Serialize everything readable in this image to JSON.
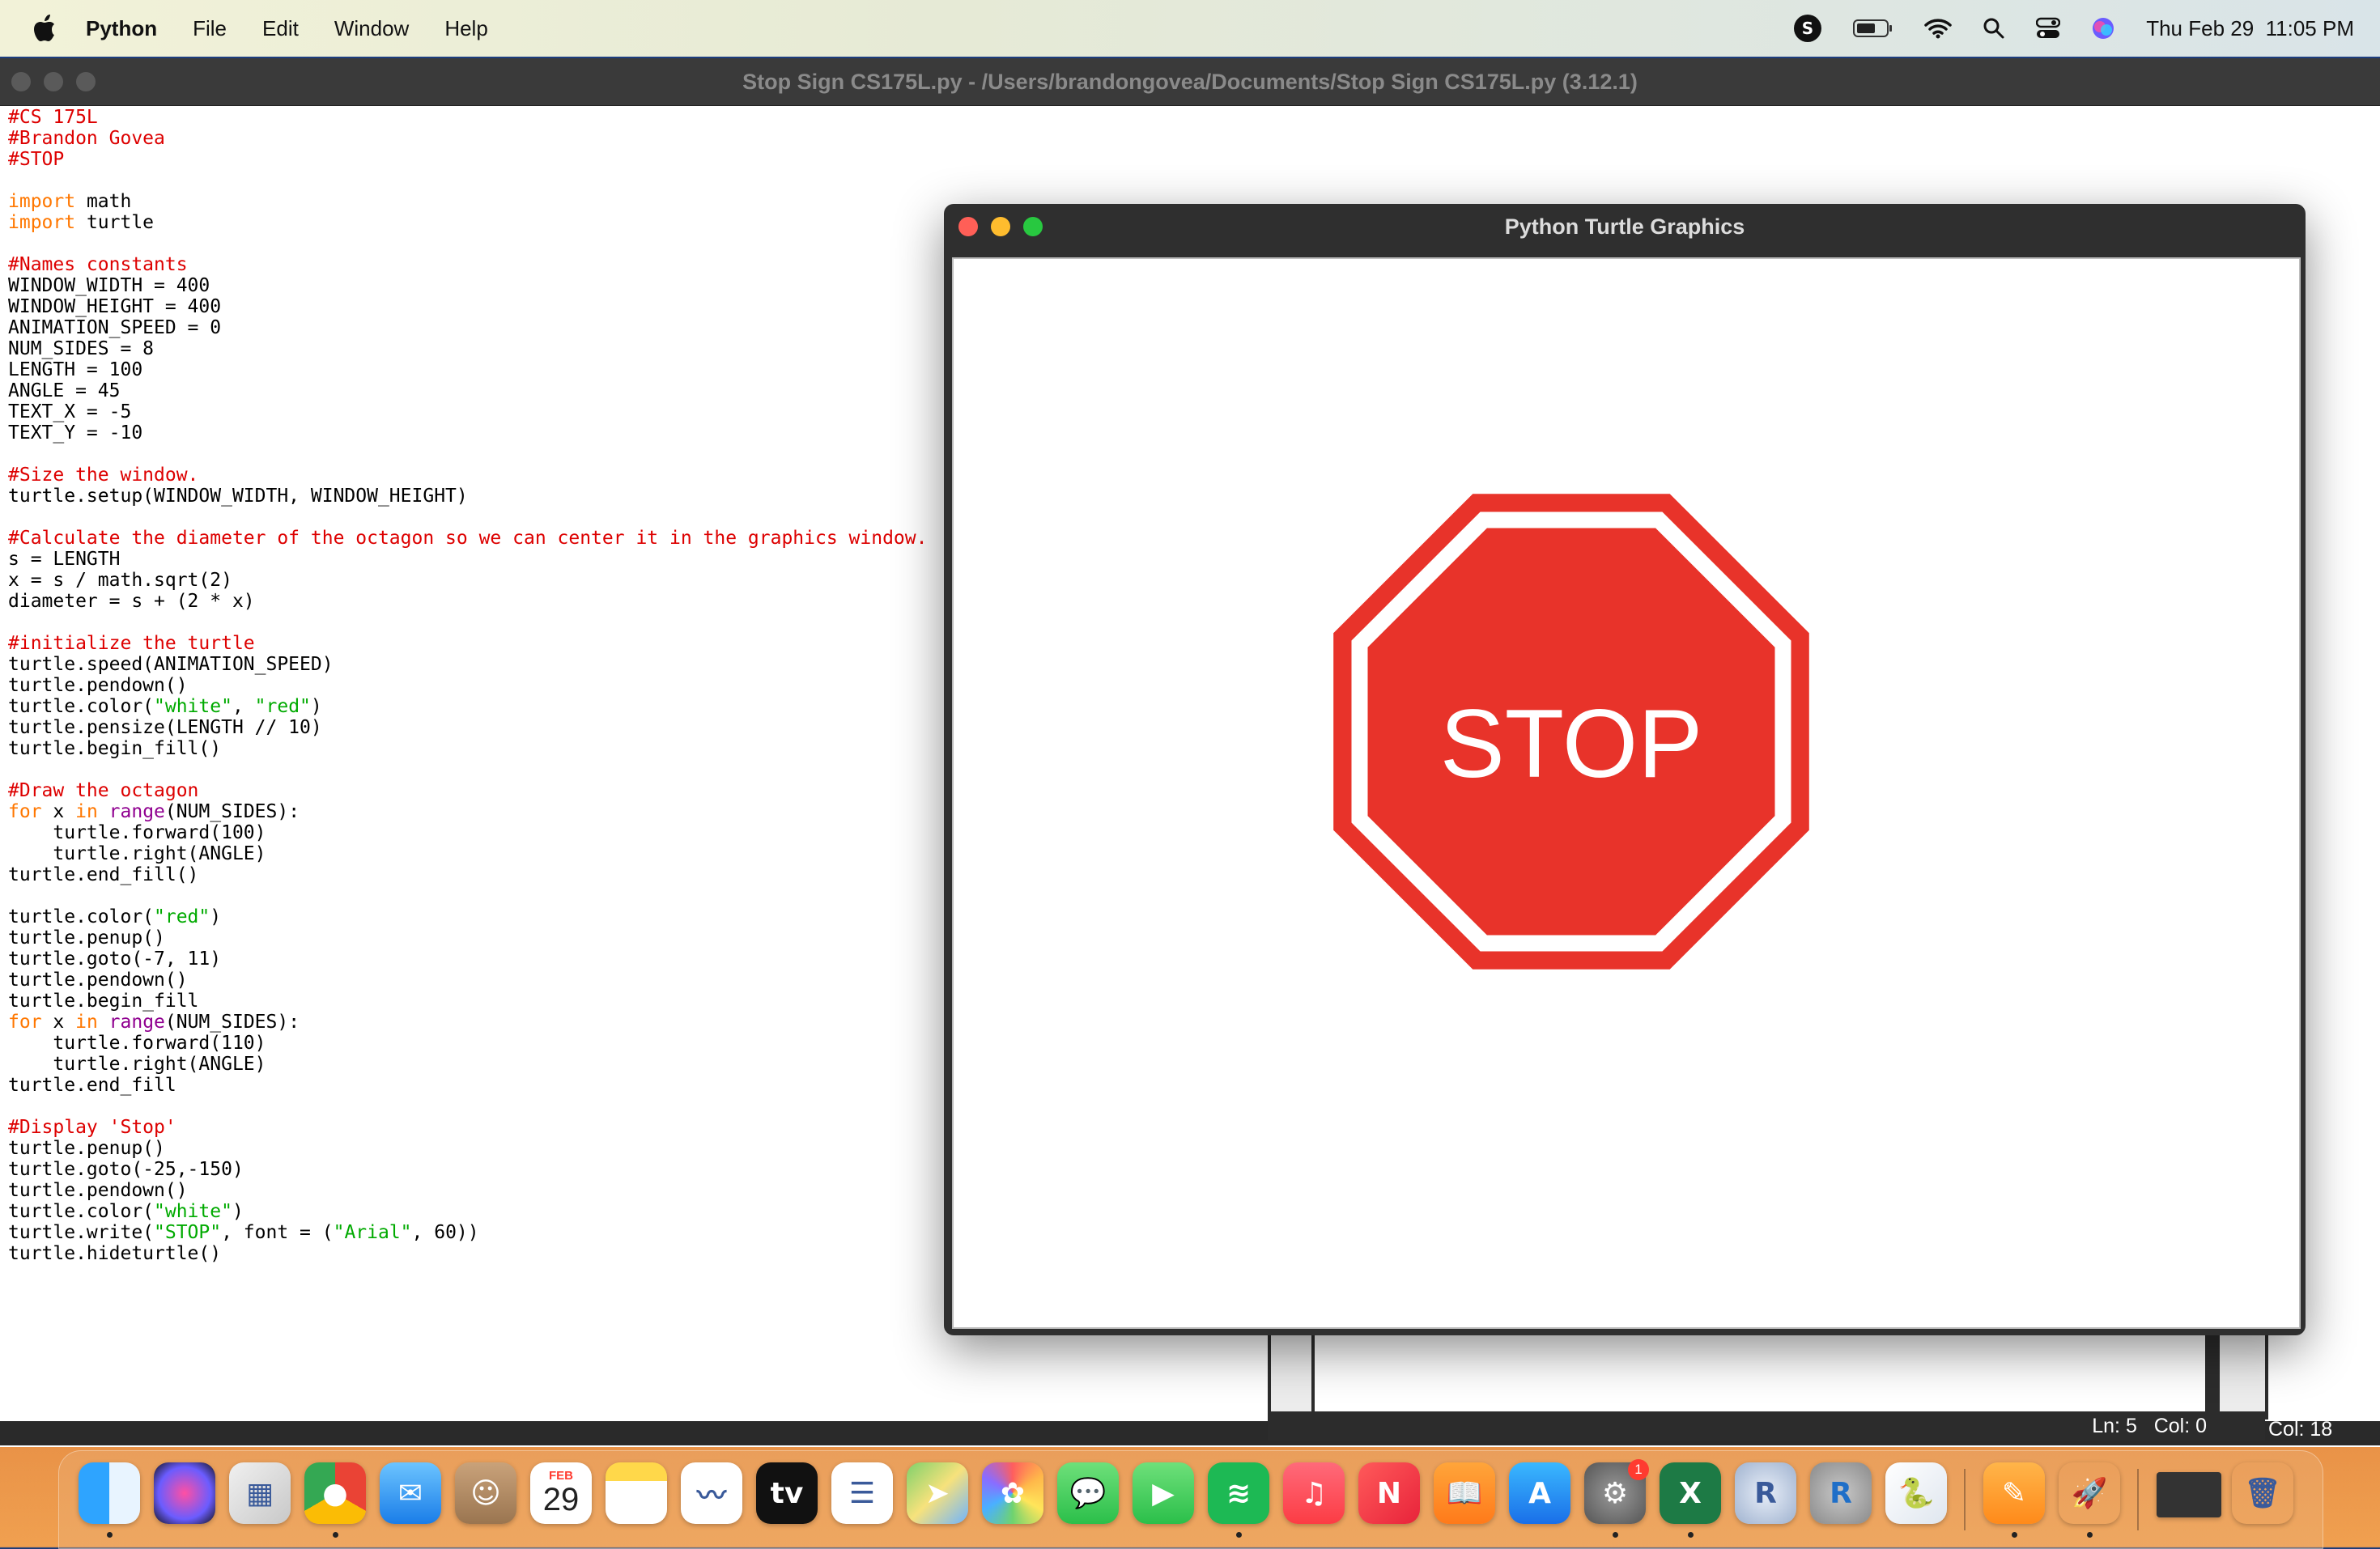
{
  "menubar": {
    "app": "Python",
    "items": [
      "File",
      "Edit",
      "Window",
      "Help"
    ],
    "datetime": "Thu Feb 29  11:05 PM"
  },
  "editor": {
    "title": "Stop Sign CS175L.py - /Users/brandongovea/Documents/Stop Sign CS175L.py (3.12.1)",
    "code_lines": [
      [
        [
          "c",
          "#CS 175L"
        ]
      ],
      [
        [
          "c",
          "#Brandon Govea"
        ]
      ],
      [
        [
          "c",
          "#STOP"
        ]
      ],
      [],
      [
        [
          "k",
          "import"
        ],
        [
          "t",
          " math"
        ]
      ],
      [
        [
          "k",
          "import"
        ],
        [
          "t",
          " turtle"
        ]
      ],
      [],
      [
        [
          "c",
          "#Names constants"
        ]
      ],
      [
        [
          "t",
          "WINDOW_WIDTH = 400"
        ]
      ],
      [
        [
          "t",
          "WINDOW_HEIGHT = 400"
        ]
      ],
      [
        [
          "t",
          "ANIMATION_SPEED = 0"
        ]
      ],
      [
        [
          "t",
          "NUM_SIDES = 8"
        ]
      ],
      [
        [
          "t",
          "LENGTH = 100"
        ]
      ],
      [
        [
          "t",
          "ANGLE = 45"
        ]
      ],
      [
        [
          "t",
          "TEXT_X = -5"
        ]
      ],
      [
        [
          "t",
          "TEXT_Y = -10"
        ]
      ],
      [],
      [
        [
          "c",
          "#Size the window."
        ]
      ],
      [
        [
          "t",
          "turtle.setup(WINDOW_WIDTH, WINDOW_HEIGHT)"
        ]
      ],
      [],
      [
        [
          "c",
          "#Calculate the diameter of the octagon so we can center it in the graphics window."
        ]
      ],
      [
        [
          "t",
          "s = LENGTH"
        ]
      ],
      [
        [
          "t",
          "x = s / math.sqrt(2)"
        ]
      ],
      [
        [
          "t",
          "diameter = s + (2 * x)"
        ]
      ],
      [],
      [
        [
          "c",
          "#initialize the turtle"
        ]
      ],
      [
        [
          "t",
          "turtle.speed(ANIMATION_SPEED)"
        ]
      ],
      [
        [
          "t",
          "turtle.pendown()"
        ]
      ],
      [
        [
          "t",
          "turtle.color("
        ],
        [
          "s",
          "\"white\""
        ],
        [
          "t",
          ", "
        ],
        [
          "s",
          "\"red\""
        ],
        [
          "t",
          ")"
        ]
      ],
      [
        [
          "t",
          "turtle.pensize(LENGTH // 10)"
        ]
      ],
      [
        [
          "t",
          "turtle.begin_fill()"
        ]
      ],
      [],
      [
        [
          "c",
          "#Draw the octagon"
        ]
      ],
      [
        [
          "k",
          "for"
        ],
        [
          "t",
          " x "
        ],
        [
          "k",
          "in"
        ],
        [
          "t",
          " "
        ],
        [
          "b",
          "range"
        ],
        [
          "t",
          "(NUM_SIDES):"
        ]
      ],
      [
        [
          "t",
          "    turtle.forward(100)"
        ]
      ],
      [
        [
          "t",
          "    turtle.right(ANGLE)"
        ]
      ],
      [
        [
          "t",
          "turtle.end_fill()"
        ]
      ],
      [],
      [
        [
          "t",
          "turtle.color("
        ],
        [
          "s",
          "\"red\""
        ],
        [
          "t",
          ")"
        ]
      ],
      [
        [
          "t",
          "turtle.penup()"
        ]
      ],
      [
        [
          "t",
          "turtle.goto(-7, 11)"
        ]
      ],
      [
        [
          "t",
          "turtle.pendown()"
        ]
      ],
      [
        [
          "t",
          "turtle.begin_fill"
        ]
      ],
      [
        [
          "k",
          "for"
        ],
        [
          "t",
          " x "
        ],
        [
          "k",
          "in"
        ],
        [
          "t",
          " "
        ],
        [
          "b",
          "range"
        ],
        [
          "t",
          "(NUM_SIDES):"
        ]
      ],
      [
        [
          "t",
          "    turtle.forward(110)"
        ]
      ],
      [
        [
          "t",
          "    turtle.right(ANGLE)"
        ]
      ],
      [
        [
          "t",
          "turtle.end_fill"
        ]
      ],
      [],
      [
        [
          "c",
          "#Display 'Stop'"
        ]
      ],
      [
        [
          "t",
          "turtle.penup()"
        ]
      ],
      [
        [
          "t",
          "turtle.goto(-25,-150)"
        ]
      ],
      [
        [
          "t",
          "turtle.pendown()"
        ]
      ],
      [
        [
          "t",
          "turtle.color("
        ],
        [
          "s",
          "\"white\""
        ],
        [
          "t",
          ")"
        ]
      ],
      [
        [
          "t",
          "turtle.write("
        ],
        [
          "s",
          "\"STOP\""
        ],
        [
          "t",
          ", font = ("
        ],
        [
          "s",
          "\"Arial\""
        ],
        [
          "t",
          ", 60))"
        ]
      ],
      [
        [
          "t",
          "turtle.hideturtle()"
        ]
      ]
    ],
    "status": "Ln: 5   Col: 0",
    "status_right": "Col: 18"
  },
  "turtle_window": {
    "title": "Python Turtle Graphics",
    "sign_text": "STOP",
    "sign_color": "#e8332a",
    "sign_inner_color": "#ffffff"
  },
  "dock": {
    "calendar_month": "FEB",
    "calendar_day": "29",
    "settings_badge": "1",
    "apps": [
      "finder-icon",
      "siri-icon",
      "launchpad-icon",
      "chrome-icon",
      "mail-icon",
      "contacts-icon",
      "calendar-icon",
      "notes-icon",
      "freeform-icon",
      "apple-tv-icon",
      "reminders-icon",
      "maps-icon",
      "photos-icon",
      "messages-icon",
      "facetime-icon",
      "spotify-icon",
      "music-icon",
      "news-icon",
      "books-icon",
      "app-store-icon",
      "system-settings-icon",
      "excel-icon",
      "r-icon",
      "rstudio-icon",
      "python-launcher-icon",
      "pages-icon",
      "rocket-icon",
      "window-thumbnail-icon",
      "trash-icon"
    ],
    "accent_colors": {
      "chrome": "#4285f4",
      "spotify": "#1db954",
      "excel": "#1d7a45",
      "music": "#fc3c44"
    }
  }
}
